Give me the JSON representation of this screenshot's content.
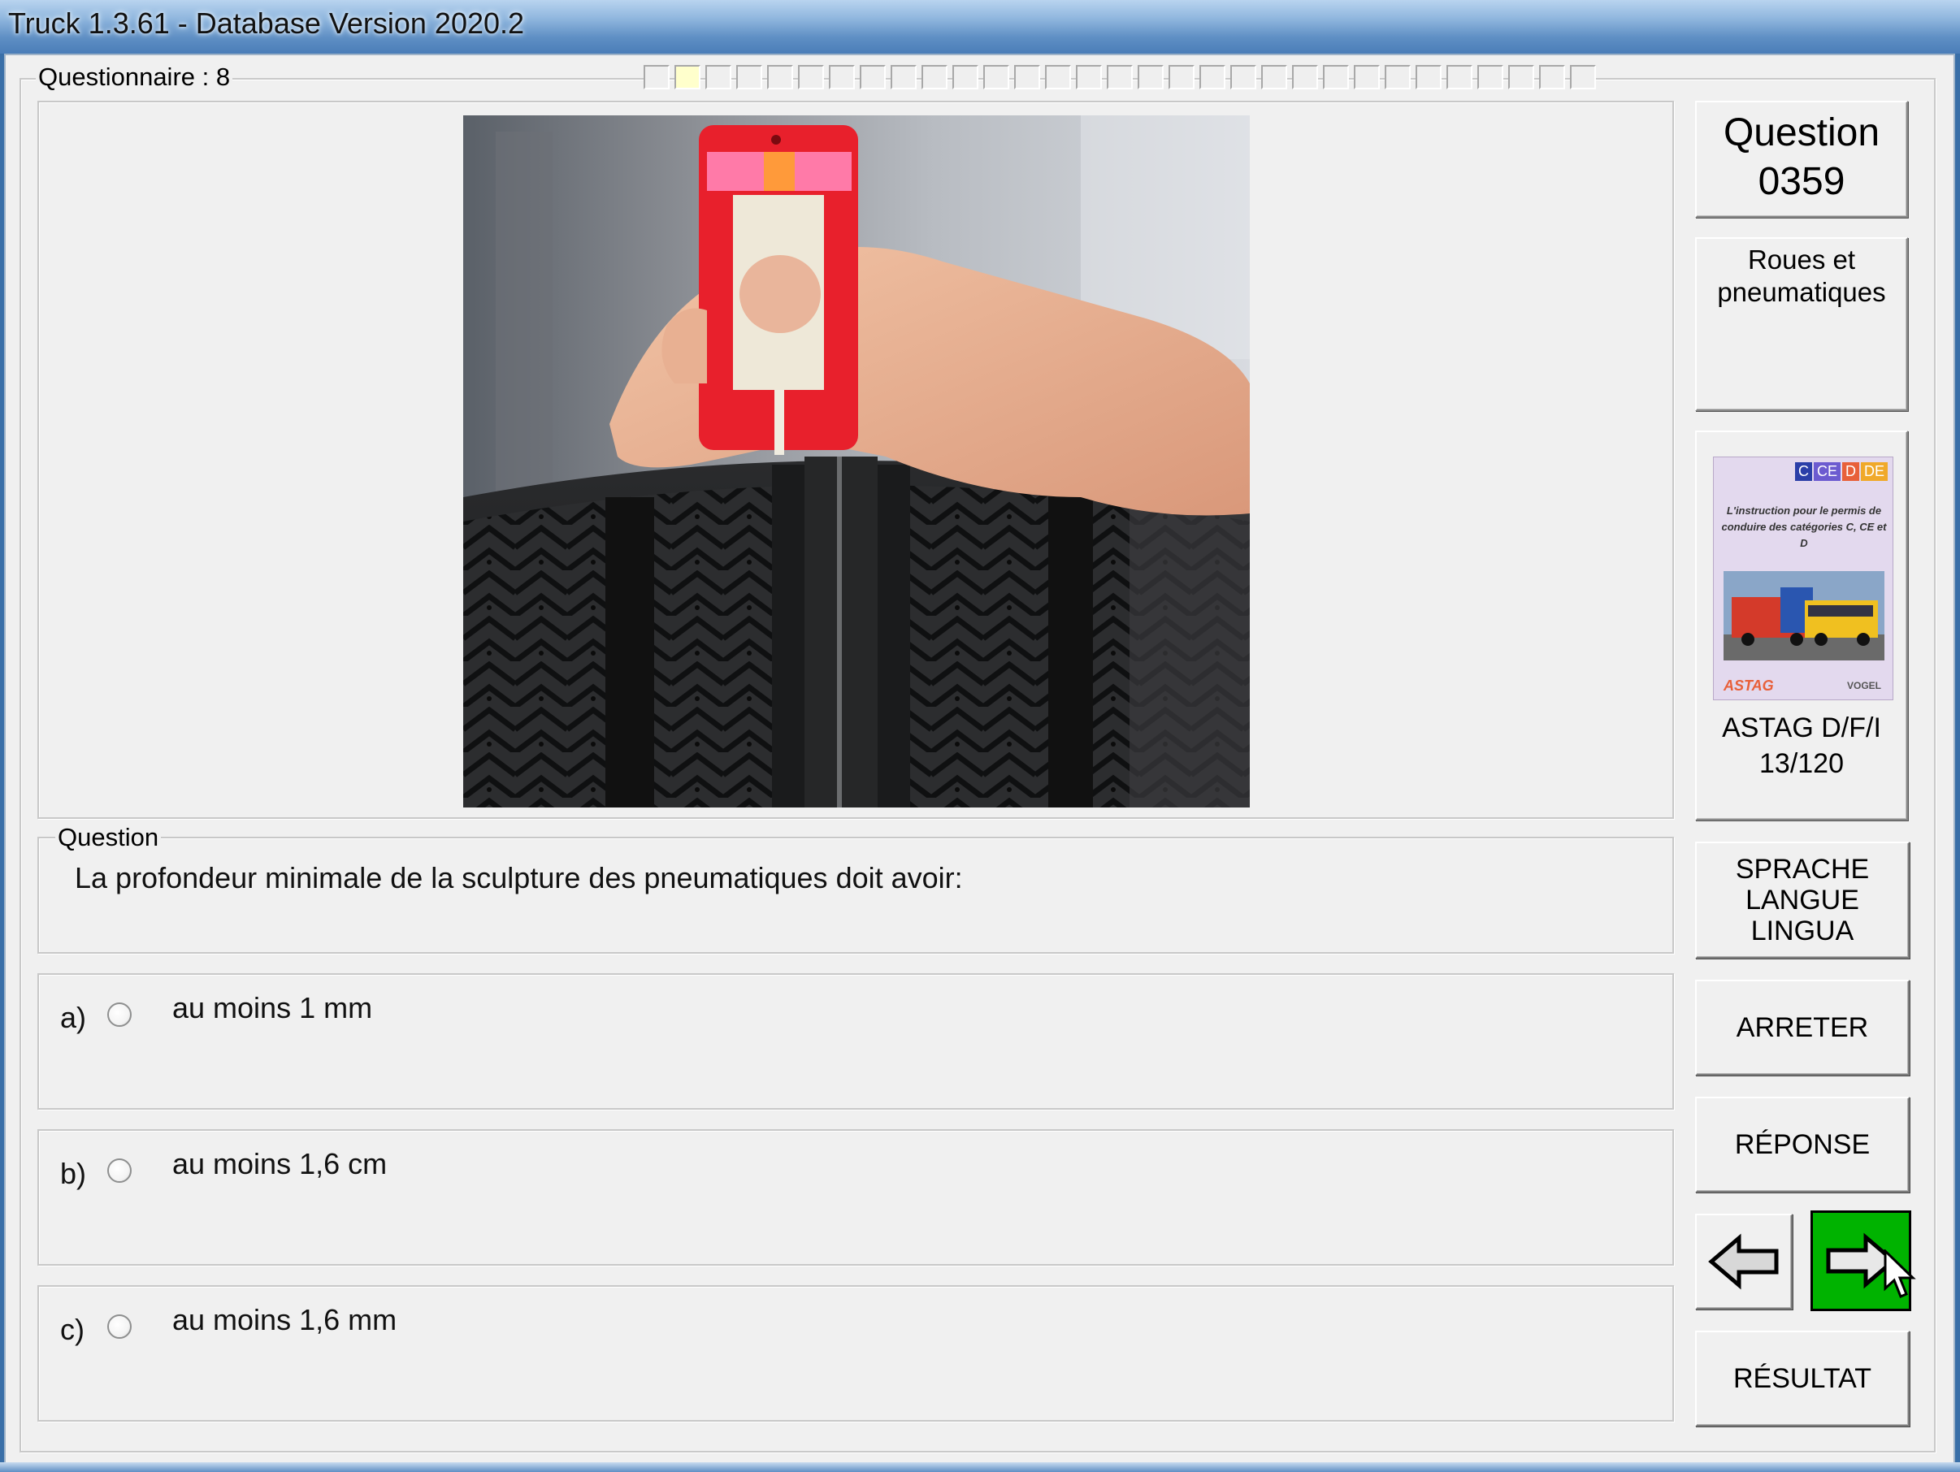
{
  "window": {
    "title": "Truck 1.3.61 - Database Version 2020.2"
  },
  "questionnaire": {
    "label": "Questionnaire : 8",
    "progress_total": 31,
    "progress_current": 2
  },
  "question_box": {
    "line1": "Question",
    "line2": "0359"
  },
  "category": {
    "line1": "Roues et",
    "line2": "pneumatiques"
  },
  "book": {
    "badges": [
      "C",
      "CE",
      "D",
      "DE"
    ],
    "cover_text": "L'instruction pour le permis de conduire des catégories C, CE et D",
    "publisher_left": "ASTAG",
    "publisher_right": "VOGEL",
    "ref_line1": "ASTAG D/F/I",
    "ref_line2": "13/120"
  },
  "question": {
    "group_label": "Question",
    "text": "La profondeur minimale de la sculpture des pneumatiques doit avoir:"
  },
  "answers": [
    {
      "letter": "a)",
      "text": "au moins 1 mm",
      "selected": false
    },
    {
      "letter": "b)",
      "text": "au moins 1,6 cm",
      "selected": false
    },
    {
      "letter": "c)",
      "text": "au moins 1,6 mm",
      "selected": false
    }
  ],
  "buttons": {
    "language_l1": "SPRACHE",
    "language_l2": "LANGUE",
    "language_l3": "LINGUA",
    "stop": "ARRETER",
    "answer": "RÉPONSE",
    "result": "RÉSULTAT"
  },
  "colors": {
    "next_button": "#00b300",
    "progress_current": "#ffffcc",
    "window_bg": "#f0f0f0"
  },
  "icons": {
    "prev": "left-arrow-icon",
    "next": "right-arrow-icon",
    "cursor": "mouse-cursor-icon"
  }
}
